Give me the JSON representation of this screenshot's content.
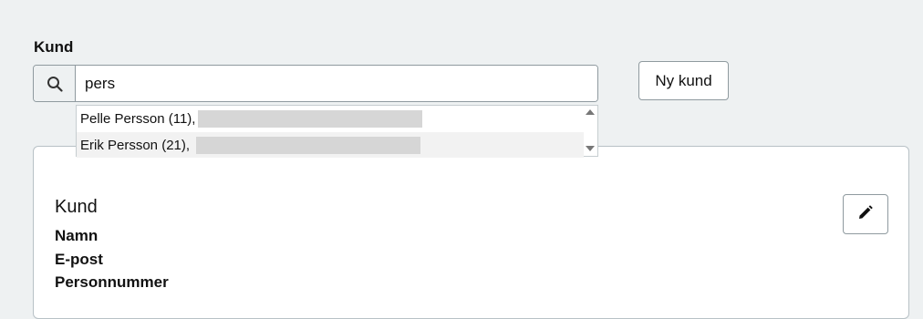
{
  "customer_field": {
    "label": "Kund",
    "search_value": "pers",
    "new_customer_button": "Ny kund"
  },
  "suggestions": [
    {
      "pre": "Pelle ",
      "match": "Pers",
      "post": "son (11),"
    },
    {
      "pre": "Erik ",
      "match": "Pers",
      "post": "son (21), "
    }
  ],
  "customer_card": {
    "title": "Kund",
    "fields": [
      "Namn",
      "E-post",
      "Personnummer"
    ]
  },
  "icons": {
    "search": "search-icon",
    "edit": "pencil-icon"
  },
  "colors": {
    "background": "#eef1f2",
    "border": "#8f9a9f",
    "redaction": "#d6d6d6"
  }
}
